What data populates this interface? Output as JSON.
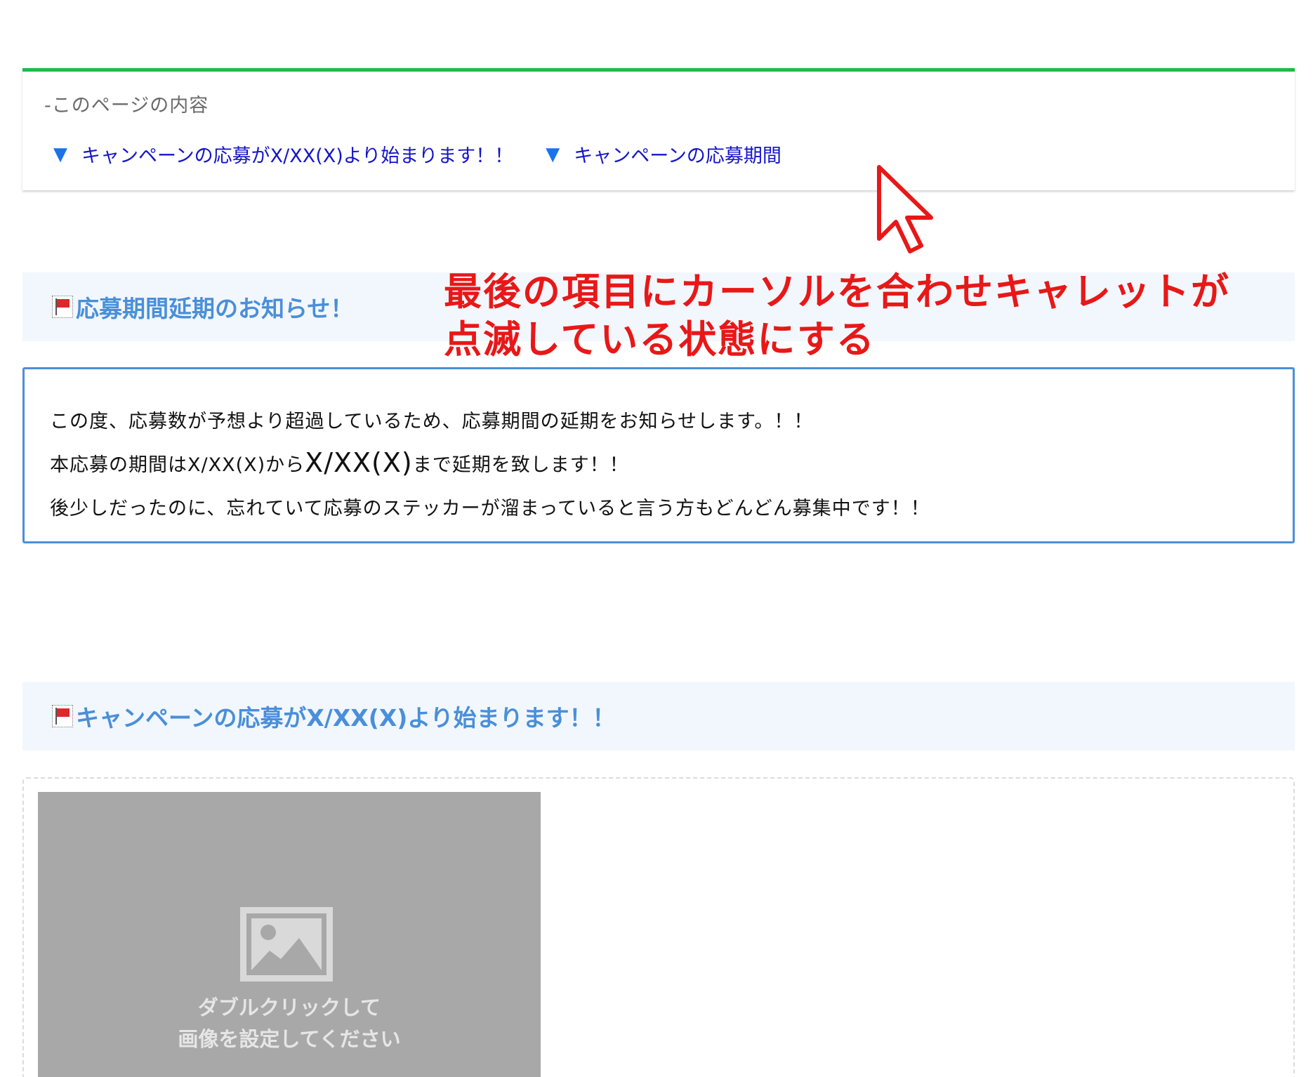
{
  "toc": {
    "title": "-このページの内容",
    "links": [
      {
        "marker": "▼",
        "label": "キャンペーンの応募がX/XX(X)より始まります！！"
      },
      {
        "marker": "▼",
        "label": "キャンペーンの応募期間"
      }
    ]
  },
  "sections": [
    {
      "icon": "flag-icon",
      "heading": "応募期間延期のお知らせ！"
    },
    {
      "icon": "flag-icon",
      "heading": "キャンペーンの応募がX/XX(X)より始まります！！"
    }
  ],
  "notice": {
    "line1": "この度、応募数が予想より超過しているため、応募期間の延期をお知らせします。！！",
    "line2_a": "本応募の期間はX/XX(X)から",
    "line2_b": "X/XX(X)",
    "line2_c": "まで延期を致します！！",
    "line3": "後少しだったのに、忘れていて応募のステッカーが溜まっていると言う方もどんどん募集中です！！"
  },
  "image_placeholder": {
    "icon": "picture-icon",
    "line1": "ダブルクリックして",
    "line2": "画像を設定してください"
  },
  "annotation": {
    "line1": "最後の項目にカーソルを合わせキャレットが",
    "line2": "点滅している状態にする",
    "color": "#e81818"
  },
  "colors": {
    "toc_border": "#1fba4b",
    "link": "#1515c8",
    "heading": "#4a8fd9",
    "heading_bg": "#f2f7fd",
    "notice_border": "#4a8fd9"
  }
}
